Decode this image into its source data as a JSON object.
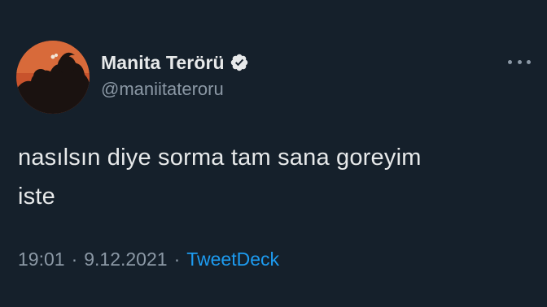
{
  "tweet": {
    "display_name": "Manita Terörü",
    "handle": "@maniitateroru",
    "text_line1": "nasılsın diye sorma tam sana goreyim",
    "text_line2": "iste",
    "time": "19:01",
    "date": "9.12.2021",
    "separator": "·",
    "source": "TweetDeck"
  },
  "icons": {
    "verified": "verified-badge-icon",
    "more": "more-horizontal-icon"
  },
  "colors": {
    "background": "#15202b",
    "primary_text": "#e7e9ea",
    "secondary_text": "#8b98a5",
    "link": "#1d9bf0",
    "avatar_background": "#c8532c"
  }
}
